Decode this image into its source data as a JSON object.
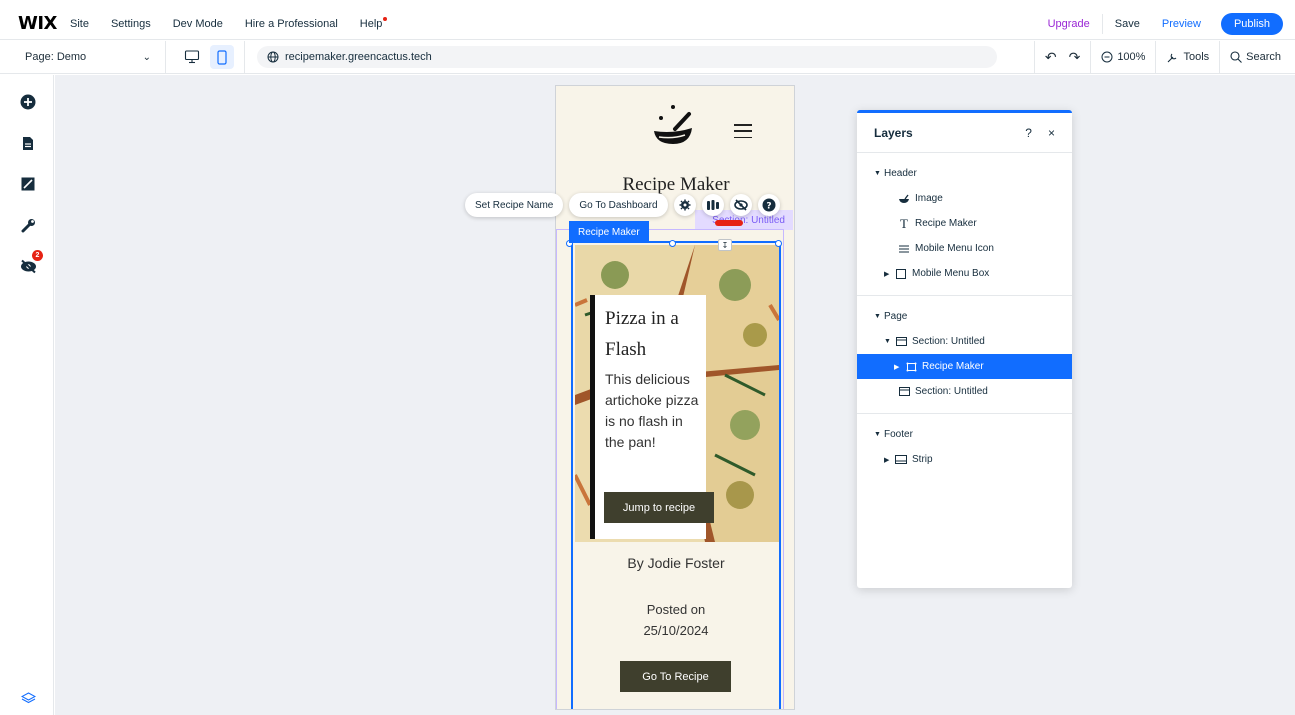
{
  "topbar": {
    "logo": "WIX",
    "menu": [
      "Site",
      "Settings",
      "Dev Mode",
      "Hire a Professional",
      "Help"
    ],
    "upgrade": "Upgrade",
    "save": "Save",
    "preview": "Preview",
    "publish": "Publish"
  },
  "pagebar": {
    "page_label": "Page:",
    "page_value": "Demo",
    "url": "recipemaker.greencactus.tech",
    "zoom": "100%",
    "tools": "Tools",
    "search": "Search"
  },
  "rail": {
    "notification_count": "2"
  },
  "phone": {
    "title": "Recipe Maker",
    "section_label": "Section: Untitled"
  },
  "selection": {
    "tag": "Recipe Maker",
    "actions": [
      "Set Recipe Name",
      "Go To Dashboard"
    ]
  },
  "recipe": {
    "title_line1": "Pizza in a",
    "title_line2": "Flash",
    "description": "This delicious artichoke pizza is no flash in the pan!",
    "jump_button": "Jump to recipe",
    "author": "By Jodie Foster",
    "posted_label": "Posted on",
    "posted_date": "25/10/2024",
    "goto_button": "Go To Recipe"
  },
  "layers": {
    "title": "Layers",
    "help": "?",
    "close": "×",
    "header": {
      "label": "Header",
      "items": [
        "Image",
        "Recipe Maker",
        "Mobile Menu Icon",
        "Mobile Menu Box"
      ]
    },
    "page": {
      "label": "Page",
      "section1": "Section: Untitled",
      "selected": "Recipe Maker",
      "section2": "Section: Untitled"
    },
    "footer": {
      "label": "Footer",
      "strip": "Strip"
    }
  },
  "colors": {
    "accent": "#116dff",
    "upgrade": "#9a27d5",
    "cream": "#f8f4e9",
    "button_dark": "#3f3f2d",
    "alert": "#e62214"
  }
}
